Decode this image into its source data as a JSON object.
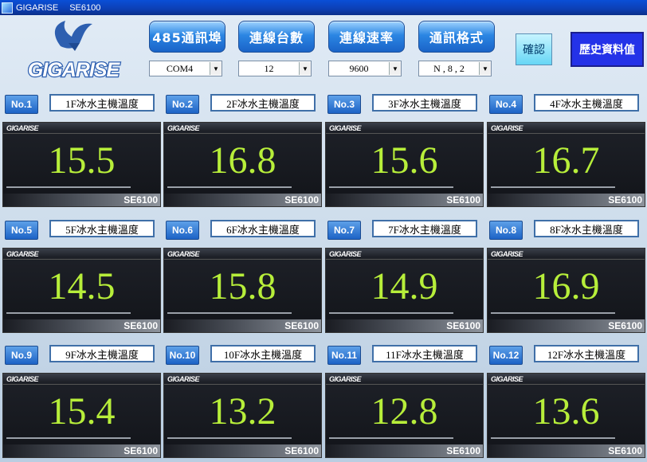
{
  "window": {
    "app_name": "GIGARISE",
    "model": "SE6100"
  },
  "logo_text": "GIGARISE",
  "controls": {
    "buttons": [
      "485通訊埠",
      "連線台數",
      "連線速率",
      "通訊格式"
    ],
    "combos": [
      "COM4",
      "12",
      "9600",
      "N , 8 , 2"
    ],
    "confirm_label": "確認",
    "history_label": "歷史資料值"
  },
  "channels": [
    {
      "no": "No.1",
      "name": "1F冰水主機溫度",
      "value": "15.5",
      "brand": "GIGARISE",
      "model": "SE6100"
    },
    {
      "no": "No.2",
      "name": "2F冰水主機溫度",
      "value": "16.8",
      "brand": "GIGARISE",
      "model": "SE6100"
    },
    {
      "no": "No.3",
      "name": "3F冰水主機溫度",
      "value": "15.6",
      "brand": "GIGARISE",
      "model": "SE6100"
    },
    {
      "no": "No.4",
      "name": "4F冰水主機溫度",
      "value": "16.7",
      "brand": "GIGARISE",
      "model": "SE6100"
    },
    {
      "no": "No.5",
      "name": "5F冰水主機溫度",
      "value": "14.5",
      "brand": "GIGARISE",
      "model": "SE6100"
    },
    {
      "no": "No.6",
      "name": "6F冰水主機溫度",
      "value": "15.8",
      "brand": "GIGARISE",
      "model": "SE6100"
    },
    {
      "no": "No.7",
      "name": "7F冰水主機溫度",
      "value": "14.9",
      "brand": "GIGARISE",
      "model": "SE6100"
    },
    {
      "no": "No.8",
      "name": "8F冰水主機溫度",
      "value": "16.9",
      "brand": "GIGARISE",
      "model": "SE6100"
    },
    {
      "no": "No.9",
      "name": "9F冰水主機溫度",
      "value": "15.4",
      "brand": "GIGARISE",
      "model": "SE6100"
    },
    {
      "no": "No.10",
      "name": "10F冰水主機溫度",
      "value": "13.2",
      "brand": "GIGARISE",
      "model": "SE6100"
    },
    {
      "no": "No.11",
      "name": "11F冰水主機溫度",
      "value": "12.8",
      "brand": "GIGARISE",
      "model": "SE6100"
    },
    {
      "no": "No.12",
      "name": "12F冰水主機溫度",
      "value": "13.6",
      "brand": "GIGARISE",
      "model": "SE6100"
    }
  ],
  "colors": {
    "value_green": "#b7ee3a",
    "accent_blue": "#1d63c6",
    "history_blue": "#2432e8",
    "titlebar": "#0a4fd6"
  }
}
